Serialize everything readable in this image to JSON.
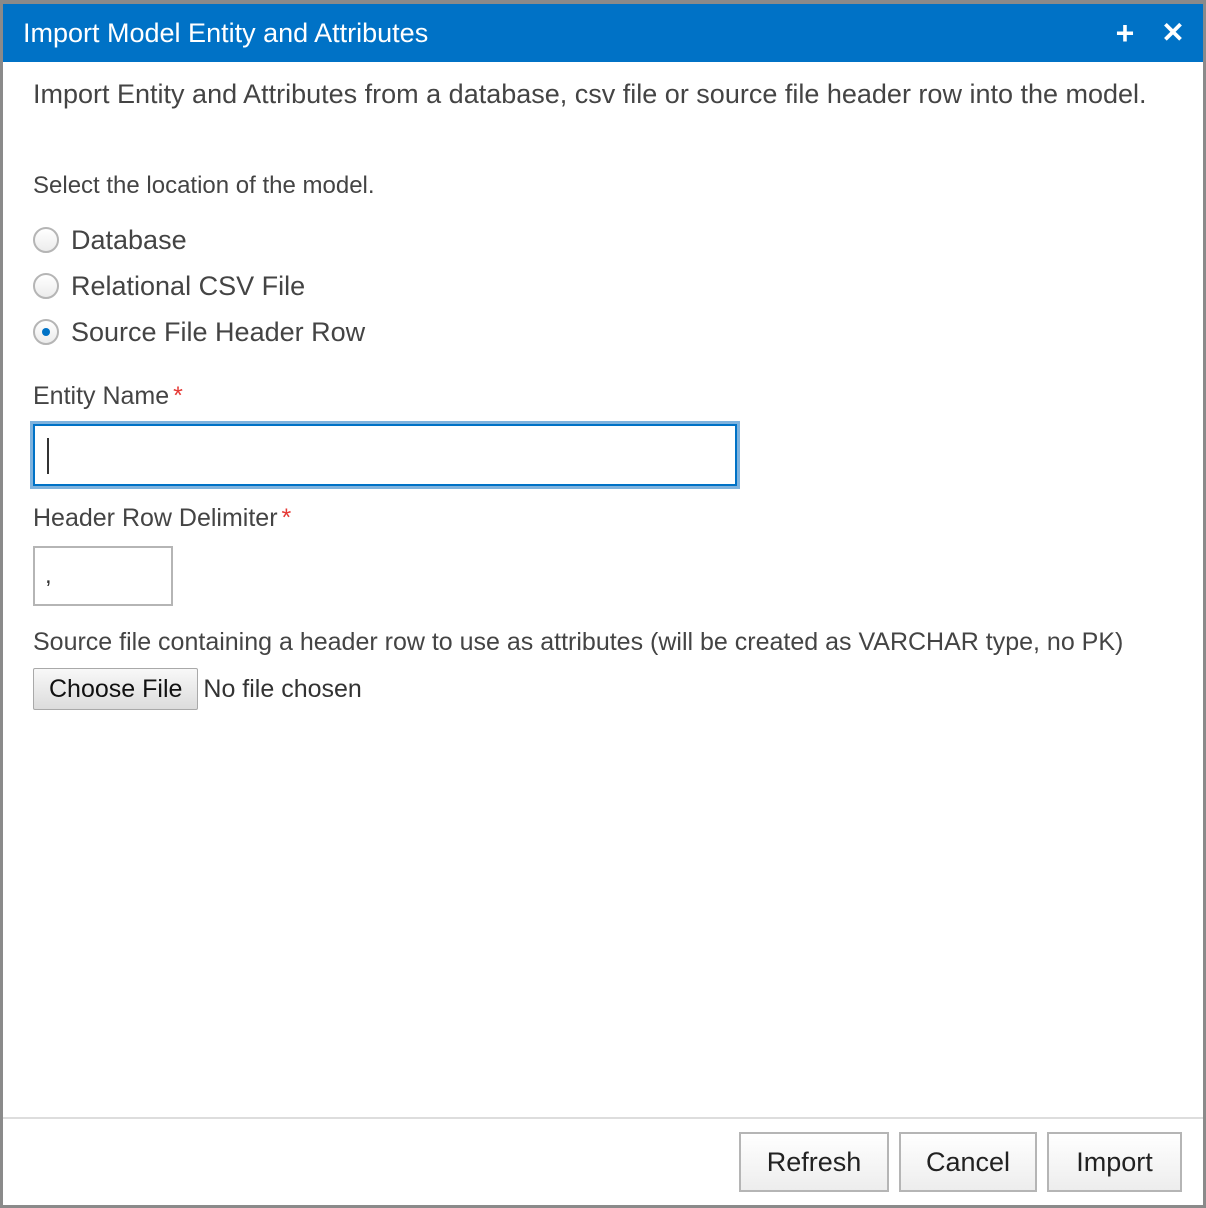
{
  "dialog": {
    "title": "Import Model Entity and Attributes",
    "maximize_icon": "plus-icon",
    "close_icon": "close-icon"
  },
  "intro_text": "Import Entity and Attributes from a database, csv file or source file header row into the model.",
  "location": {
    "label": "Select the location of the model.",
    "options": [
      {
        "label": "Database",
        "checked": false
      },
      {
        "label": "Relational CSV File",
        "checked": false
      },
      {
        "label": "Source File Header Row",
        "checked": true
      }
    ]
  },
  "entity_name": {
    "label": "Entity Name",
    "required_marker": "*",
    "value": ""
  },
  "delimiter": {
    "label": "Header Row Delimiter",
    "required_marker": "*",
    "value": ","
  },
  "source_file": {
    "label": "Source file containing a header row to use as attributes (will be created as VARCHAR type, no PK)",
    "button_label": "Choose File",
    "status": "No file chosen"
  },
  "footer": {
    "refresh_label": "Refresh",
    "cancel_label": "Cancel",
    "import_label": "Import"
  },
  "colors": {
    "accent": "#0072c6",
    "required": "#e53935"
  }
}
